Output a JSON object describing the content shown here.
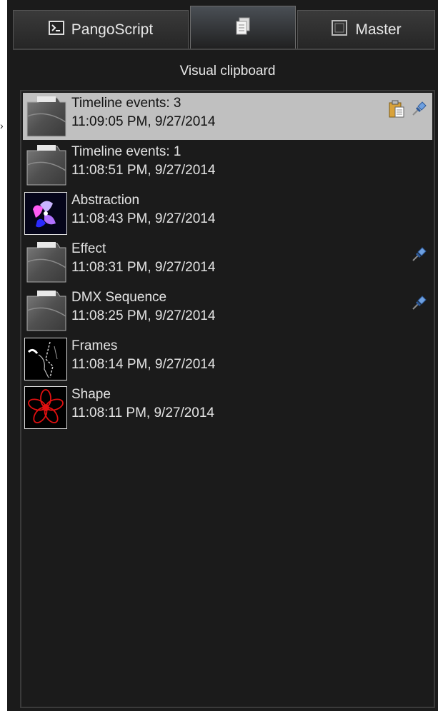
{
  "tabs": [
    {
      "label": "PangoScript",
      "icon": "terminal-icon"
    },
    {
      "label": "",
      "icon": "clipboard-pages-icon"
    },
    {
      "label": "Master",
      "icon": "square-icon"
    }
  ],
  "header": {
    "title": "Visual clipboard"
  },
  "items": [
    {
      "title": "Timeline events: 3",
      "time": "11:09:05 PM,  9/27/2014",
      "thumb": "folder",
      "selected": true,
      "pinned": true,
      "paste": true
    },
    {
      "title": "Timeline events: 1",
      "time": "11:08:51 PM,  9/27/2014",
      "thumb": "folder",
      "selected": false,
      "pinned": false,
      "paste": false
    },
    {
      "title": "Abstraction",
      "time": "11:08:43 PM,  9/27/2014",
      "thumb": "abstraction",
      "selected": false,
      "pinned": false,
      "paste": false
    },
    {
      "title": "Effect",
      "time": "11:08:31 PM,  9/27/2014",
      "thumb": "folder",
      "selected": false,
      "pinned": true,
      "paste": false
    },
    {
      "title": "DMX Sequence",
      "time": "11:08:25 PM,  9/27/2014",
      "thumb": "folder",
      "selected": false,
      "pinned": true,
      "paste": false
    },
    {
      "title": "Frames",
      "time": "11:08:14 PM,  9/27/2014",
      "thumb": "frames",
      "selected": false,
      "pinned": false,
      "paste": false
    },
    {
      "title": "Shape",
      "time": "11:08:11 PM,  9/27/2014",
      "thumb": "shape",
      "selected": false,
      "pinned": false,
      "paste": false
    }
  ],
  "colors": {
    "background": "#1b1b1b",
    "selected_row": "#c0c0c0",
    "text": "#e4e4e4",
    "pin": "#5b8fd6",
    "shape_red": "#e01010"
  }
}
